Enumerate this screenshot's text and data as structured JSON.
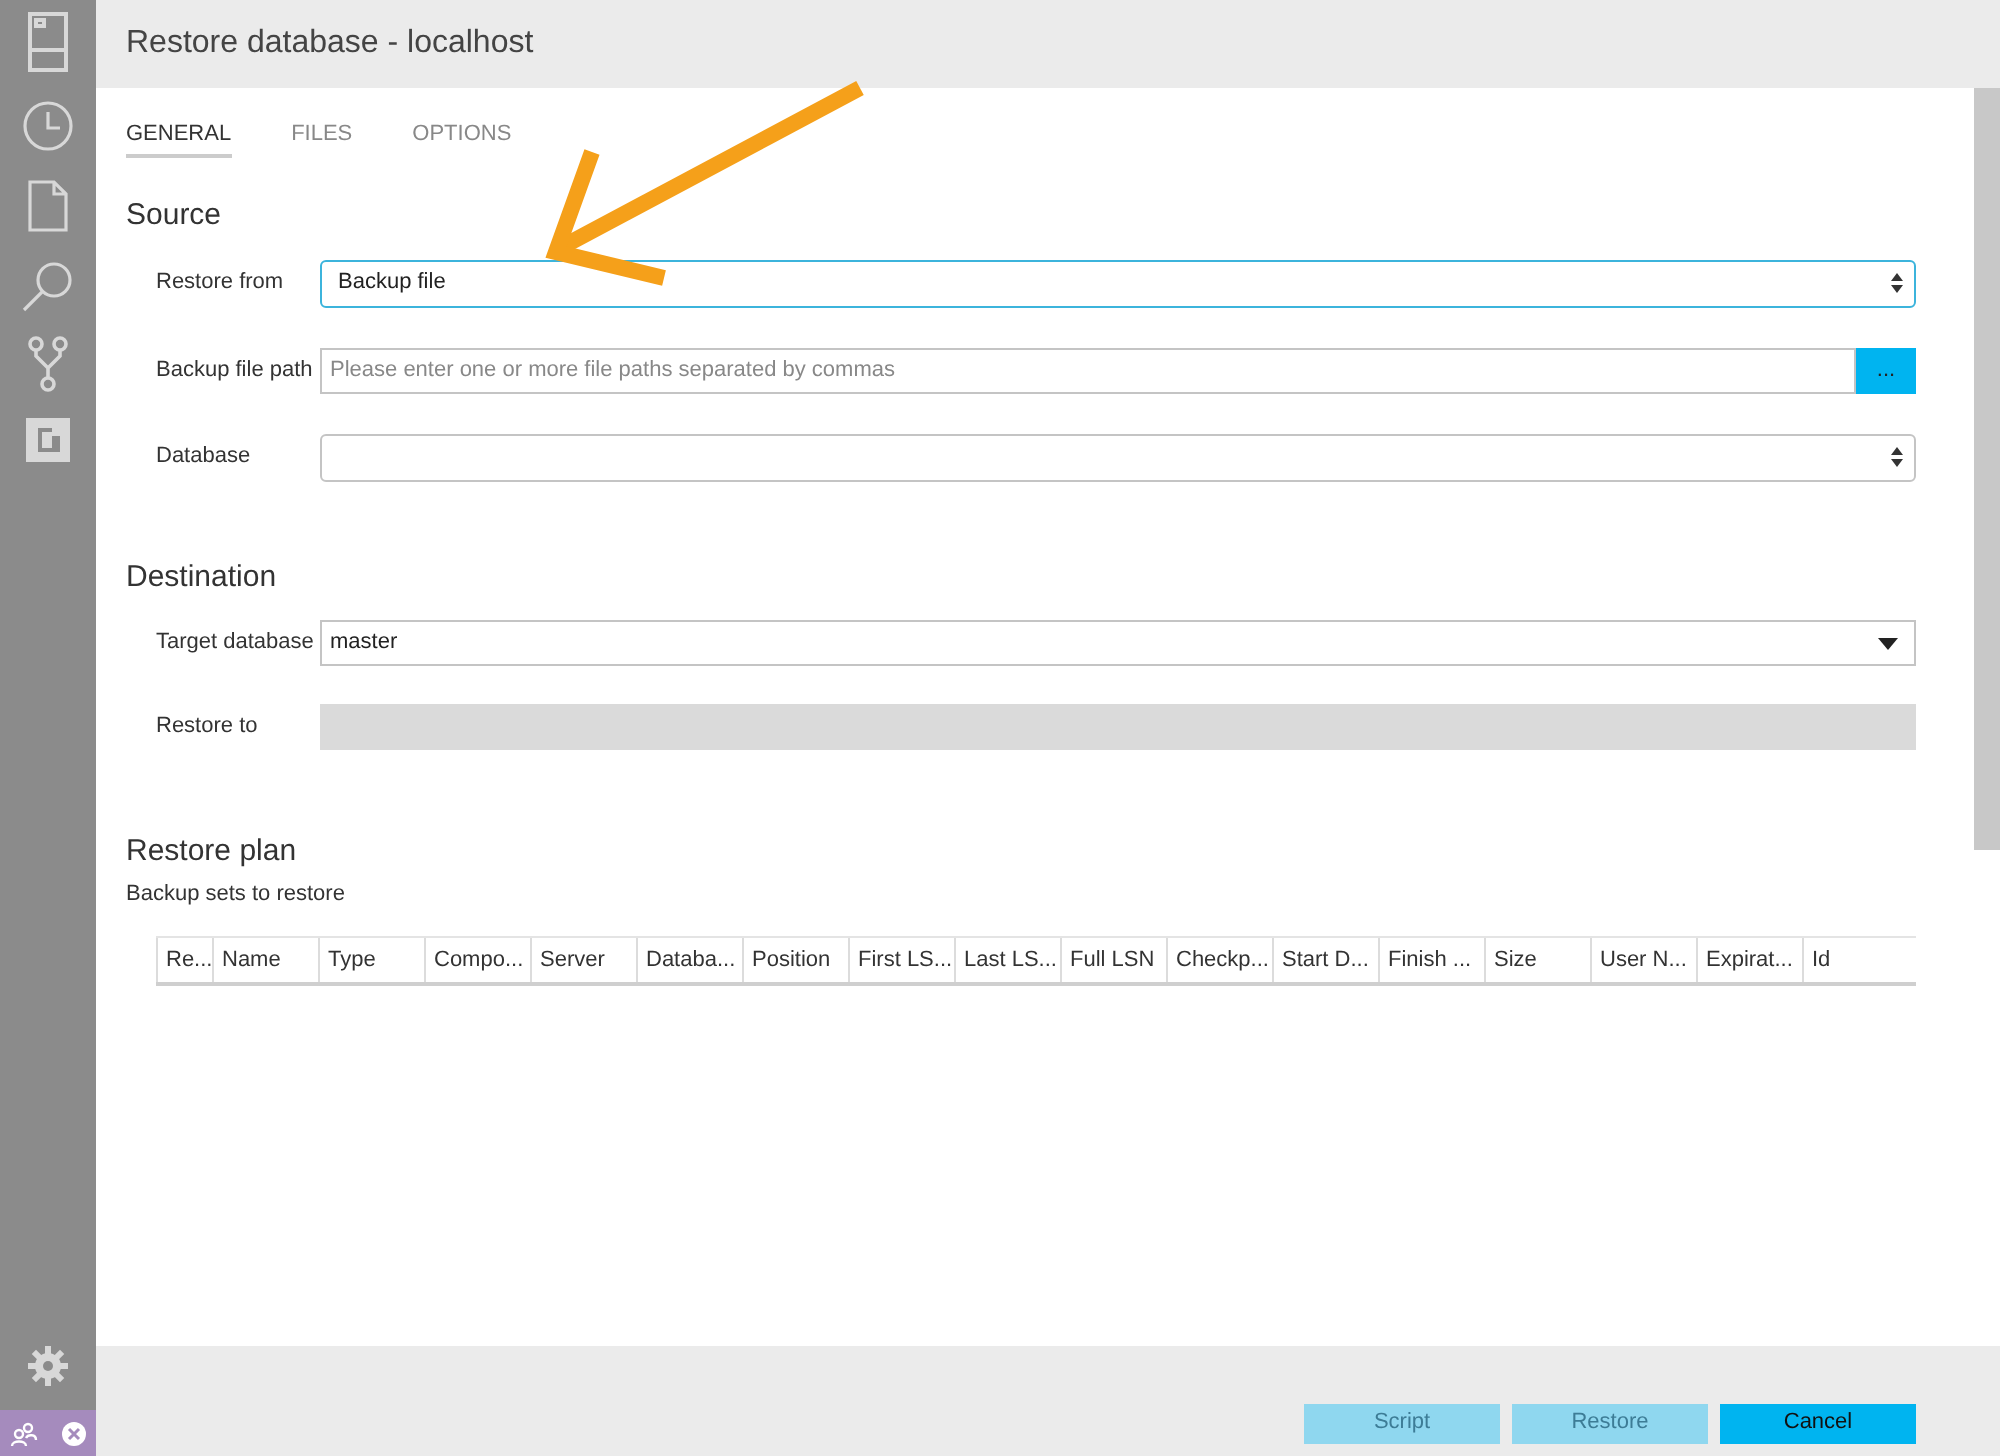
{
  "window": {
    "title": "Restore database - localhost"
  },
  "tabs": [
    {
      "label": "GENERAL",
      "selected": true
    },
    {
      "label": "FILES",
      "selected": false
    },
    {
      "label": "OPTIONS",
      "selected": false
    }
  ],
  "source": {
    "heading": "Source",
    "fields": [
      {
        "kind": "select",
        "label": "Restore from",
        "value": "Backup file",
        "focused": true
      },
      {
        "kind": "browse",
        "label": "Backup file path",
        "placeholder": "Please enter one or more file paths separated by commas",
        "button": "..."
      },
      {
        "kind": "select",
        "label": "Database",
        "focused": false
      }
    ]
  },
  "destination": {
    "heading": "Destination",
    "fields": [
      {
        "kind": "dropdown",
        "label": "Target database",
        "value": "master"
      },
      {
        "kind": "readonly",
        "label": "Restore to"
      }
    ]
  },
  "restore_plan": {
    "heading": "Restore plan",
    "subtitle": "Backup sets to restore",
    "columns": [
      "Re...",
      "Name",
      "Type",
      "Compo...",
      "Server",
      "Databa...",
      "Position",
      "First LS...",
      "Last LS...",
      "Full LSN",
      "Checkp...",
      "Start D...",
      "Finish ...",
      "Size",
      "User N...",
      "Expirat...",
      "Id"
    ]
  },
  "buttons": [
    {
      "label": "Script",
      "disabled": true
    },
    {
      "label": "Restore",
      "disabled": true
    },
    {
      "label": "Cancel",
      "disabled": false
    }
  ]
}
